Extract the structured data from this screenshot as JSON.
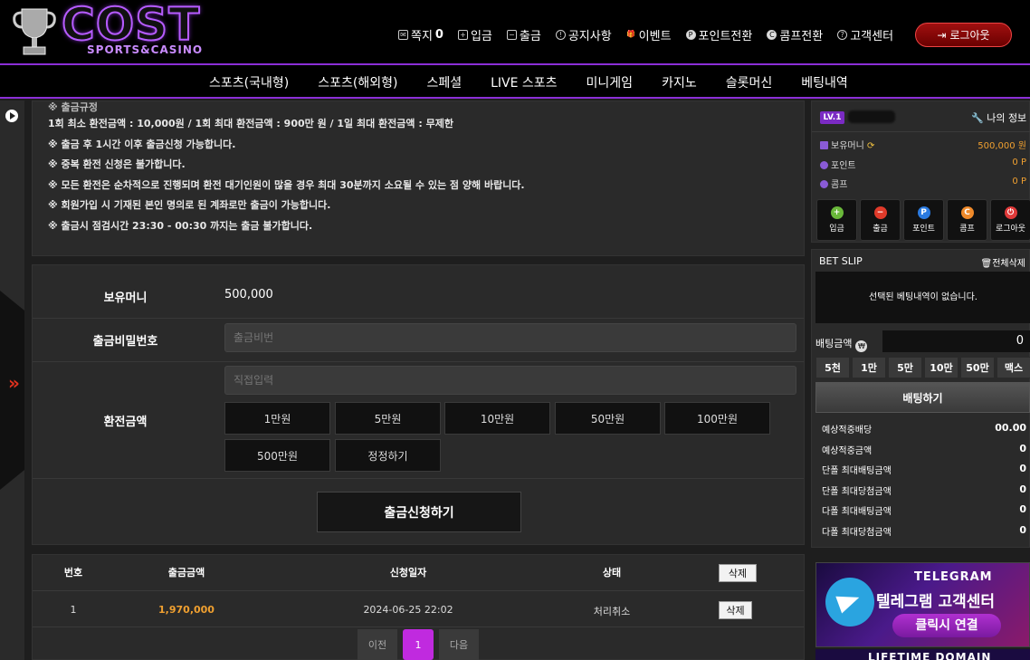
{
  "brand": {
    "name": "COST",
    "tagline": "SPORTS&CASINO"
  },
  "topnav": [
    {
      "label": "쪽지",
      "badge": "0",
      "icon": "envelope-icon"
    },
    {
      "label": "입금",
      "icon": "deposit-icon"
    },
    {
      "label": "출금",
      "icon": "withdraw-icon"
    },
    {
      "label": "공지사항",
      "icon": "notice-icon"
    },
    {
      "label": "이벤트",
      "icon": "gift-icon"
    },
    {
      "label": "포인트전환",
      "icon": "point-icon"
    },
    {
      "label": "콤프전환",
      "icon": "comp-icon"
    },
    {
      "label": "고객센터",
      "icon": "help-icon"
    }
  ],
  "logout_label": "로그아웃",
  "mainnav": [
    "스포츠(국내형)",
    "스포츠(해외형)",
    "스페셜",
    "LIVE 스포츠",
    "미니게임",
    "카지노",
    "슬롯머신",
    "베팅내역"
  ],
  "notice": {
    "title": "※ 출금규정",
    "lines": [
      "1회 최소 환전금액 : 10,000원 / 1회 최대 환전금액 : 900만 원 / 1일 최대 환전금액 : 무제한",
      "※ 출금 후 1시간 이후 출금신청 가능합니다.",
      "※ 중복 환전 신청은 불가합니다.",
      "※ 모든 환전은 순차적으로 진행되며 환전 대기인원이 많을 경우 최대 30분까지 소요될 수 있는 점 양해 바랍니다.",
      "※ 회원가입 시 기재된 본인 명의로 된 계좌로만 출금이 가능합니다.",
      "※ 출금시 점검시간 23:30 - 00:30 까지는 출금 불가합니다."
    ]
  },
  "form": {
    "balance_label": "보유머니",
    "balance_value": "500,000",
    "password_label": "출금비밀번호",
    "password_placeholder": "출금비번",
    "amount_label": "환전금액",
    "amount_placeholder": "직접입력",
    "amount_buttons": [
      "1만원",
      "5만원",
      "10만원",
      "50만원",
      "100만원",
      "500만원",
      "정정하기"
    ],
    "submit_label": "출금신청하기"
  },
  "history": {
    "columns": [
      "번호",
      "출금금액",
      "신청일자",
      "상태"
    ],
    "delete_all_label": "삭제",
    "rows": [
      {
        "no": "1",
        "amount": "1,970,000",
        "date": "2024-06-25 22:02",
        "status": "처리취소",
        "delete": "삭제"
      }
    ],
    "pager": {
      "prev": "이전",
      "current": "1",
      "next": "다음"
    }
  },
  "user": {
    "level": "LV.1",
    "my_info_label": "나의 정보",
    "balance_label": "보유머니",
    "balance_value": "500,000 원",
    "point_label": "포인트",
    "point_value": "0 P",
    "comp_label": "콤프",
    "comp_value": "0 P",
    "quick_buttons": [
      {
        "label": "입금",
        "glyph": "+",
        "color": "#6ab83a"
      },
      {
        "label": "출금",
        "glyph": "−",
        "color": "#e03a2a"
      },
      {
        "label": "포인트",
        "glyph": "P",
        "color": "#2a7ae0"
      },
      {
        "label": "콤프",
        "glyph": "C",
        "color": "#f08a2a"
      },
      {
        "label": "로그아웃",
        "glyph": "⏻",
        "color": "#e03a3a"
      }
    ]
  },
  "betslip": {
    "title": "BET SLIP",
    "delete_all": "전체삭제",
    "empty_text": "선택된 베팅내역이 없습니다.",
    "amount_label": "배팅금액",
    "amount_value": "0",
    "chips": [
      "5천",
      "1만",
      "5만",
      "10만",
      "50만",
      "맥스"
    ],
    "bet_button": "배팅하기",
    "rows": [
      {
        "label": "예상적중배당",
        "value": "00.00"
      },
      {
        "label": "예상적중금액",
        "value": "0"
      },
      {
        "label": "단폴 최대배팅금액",
        "value": "0"
      },
      {
        "label": "단폴 최대당첨금액",
        "value": "0"
      },
      {
        "label": "다폴 최대배팅금액",
        "value": "0"
      },
      {
        "label": "다폴 최대당첨금액",
        "value": "0"
      }
    ]
  },
  "banner": {
    "top": "TELEGRAM",
    "main": "텔레그램 고객센터",
    "cta": "클릭시 연결",
    "next": "LIFETIME DOMAIN"
  }
}
